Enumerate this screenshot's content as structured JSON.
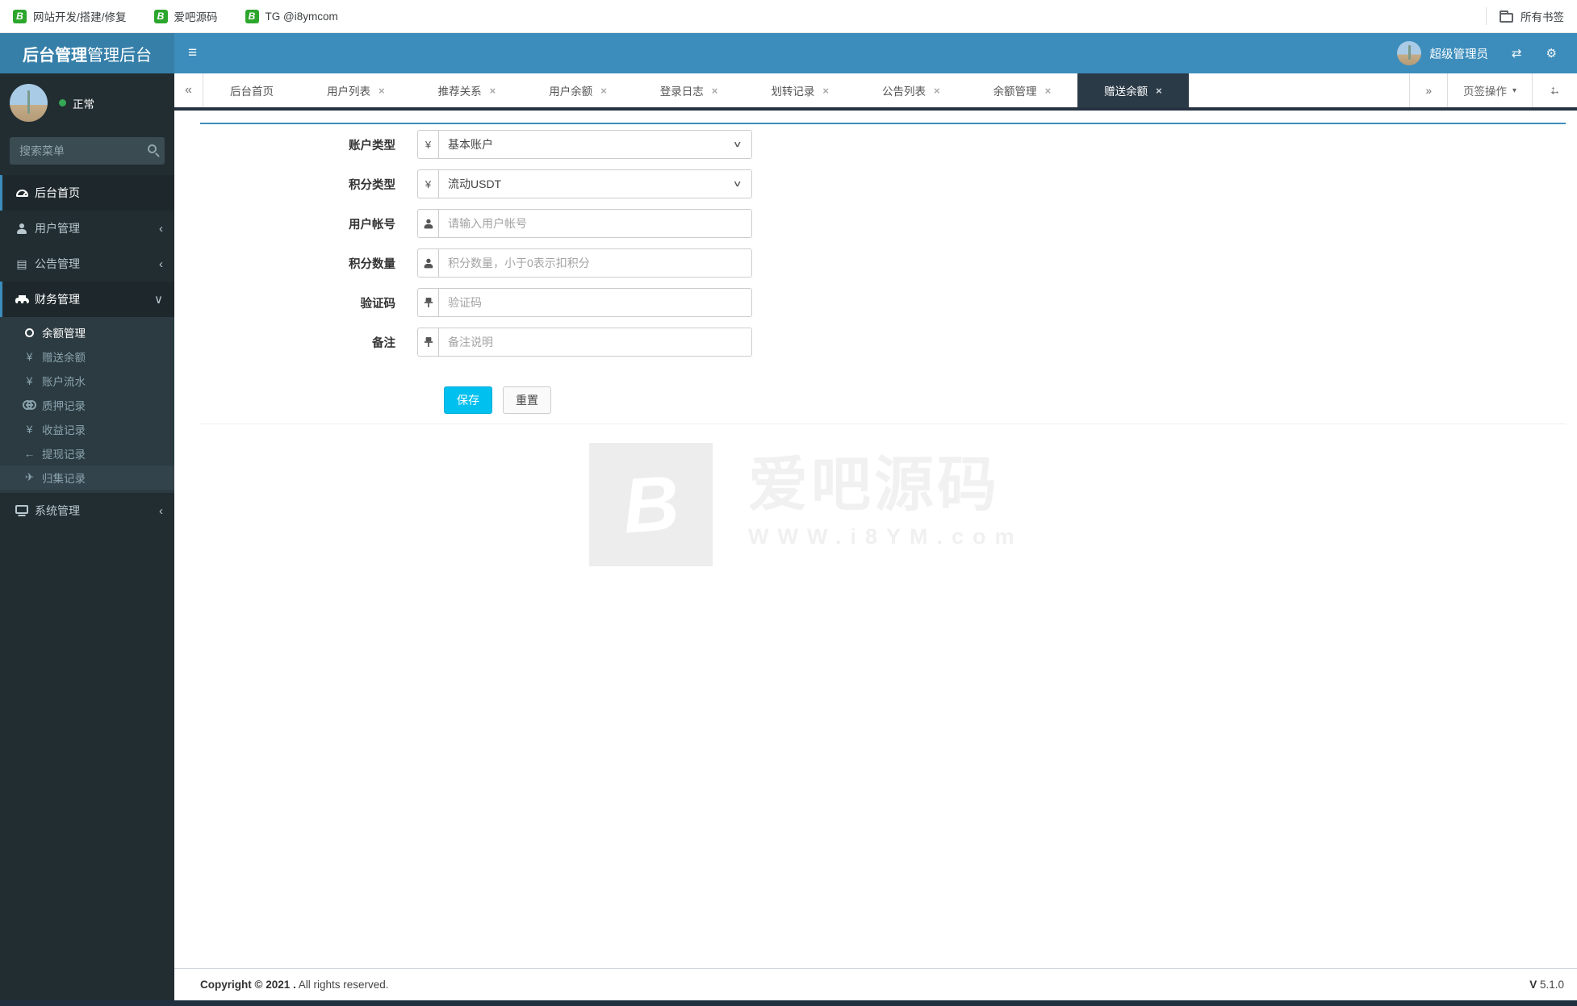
{
  "colors": {
    "navbar": "#3c8dbc",
    "logo_bg": "#367fa9",
    "sidebar_bg": "#222d32",
    "sidebar_submenu_bg": "#2c3b41",
    "active_border": "#3c8dbc",
    "active_tab_bg": "#2b3a47",
    "save_button": "#00c0ef",
    "status_green": "#35a855",
    "favicon_green": "#2ca62c",
    "panel_top_border": "#3e8ebd"
  },
  "icons": {
    "favicon_glyph": "B",
    "hamburger": "≡",
    "refresh": "⇄",
    "gear": "⚙",
    "back": "«",
    "forward": "»",
    "caret_down": "▾",
    "close": "×",
    "chevron_collapsed": "‹",
    "chevron_expanded": "∨",
    "yen": "¥",
    "arrow_left": "←",
    "jet": "✈",
    "news": "▤",
    "logo_mark": "B"
  },
  "bookmarks_bar": {
    "items": [
      {
        "label": "网站开发/搭建/修复"
      },
      {
        "label": "爱吧源码"
      },
      {
        "label": "TG  @i8ymcom"
      }
    ],
    "all_bookmarks": "所有书签"
  },
  "header": {
    "logo_bold": "后台管理",
    "logo_light": "管理后台",
    "user_name": "超级管理员"
  },
  "sidebar": {
    "status": "正常",
    "search_placeholder": "搜索菜单",
    "menu": [
      {
        "label": "后台首页"
      },
      {
        "label": "用户管理"
      },
      {
        "label": "公告管理"
      },
      {
        "label": "财务管理",
        "children": [
          {
            "label": "余额管理"
          },
          {
            "label": "赠送余额"
          },
          {
            "label": "账户流水"
          },
          {
            "label": "质押记录"
          },
          {
            "label": "收益记录"
          },
          {
            "label": "提现记录"
          },
          {
            "label": "归集记录"
          }
        ]
      },
      {
        "label": "系统管理"
      }
    ]
  },
  "tabs": {
    "items": [
      {
        "label": "后台首页"
      },
      {
        "label": "用户列表"
      },
      {
        "label": "推荐关系"
      },
      {
        "label": "用户余额"
      },
      {
        "label": "登录日志"
      },
      {
        "label": "划转记录"
      },
      {
        "label": "公告列表"
      },
      {
        "label": "余额管理"
      },
      {
        "label": "赠送余额"
      }
    ],
    "menu_label": "页签操作"
  },
  "form": {
    "fields": [
      {
        "label": "账户类型",
        "value": "基本账户"
      },
      {
        "label": "积分类型",
        "value": "流动USDT"
      },
      {
        "label": "用户帐号",
        "placeholder": "请输入用户帐号"
      },
      {
        "label": "积分数量",
        "placeholder": "积分数量，小于0表示扣积分"
      },
      {
        "label": "验证码",
        "placeholder": "验证码"
      },
      {
        "label": "备注",
        "placeholder": "备注说明"
      }
    ],
    "save_label": "保存",
    "reset_label": "重置"
  },
  "watermark": {
    "title": "爱吧源码",
    "subtitle": "WWW.i8YM.com"
  },
  "footer": {
    "copyright_bold": "Copyright © 2021 .",
    "copyright_rest": " All rights reserved.",
    "version_bold": "V",
    "version": " 5.1.0"
  }
}
